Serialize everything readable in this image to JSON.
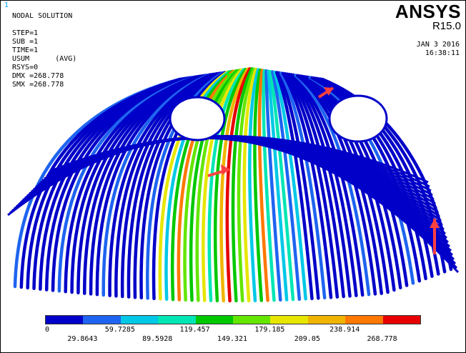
{
  "window": {
    "number": "1"
  },
  "header": {
    "plot_title": "NODAL SOLUTION",
    "step": "STEP=1",
    "sub": "SUB =1",
    "time": "TIME=1",
    "usum": "USUM      (AVG)",
    "rsys": "RSYS=0",
    "dmx": "DMX =268.778",
    "smx": "SMX =268.778"
  },
  "brand": {
    "name": "ANSYS",
    "version": "R15.0"
  },
  "timestamp": {
    "date": "JAN  3 2016",
    "time": "16:38:11"
  },
  "legend": {
    "colors": [
      "#0000c8",
      "#1e64f0",
      "#00c8e6",
      "#00e6b4",
      "#00c800",
      "#64e600",
      "#e6e600",
      "#f0b400",
      "#ff7800",
      "#e60000"
    ],
    "top_labels": [
      "0",
      "59.7285",
      "119.457",
      "179.185",
      "238.914"
    ],
    "bottom_labels": [
      "29.8643",
      "89.5928",
      "149.321",
      "209.05",
      "268.778"
    ]
  },
  "annotations": [
    {
      "name": "arrow-left-band",
      "color": "#ff4040"
    },
    {
      "name": "arrow-upper-right",
      "color": "#ff4040"
    },
    {
      "name": "arrow-right-edge",
      "color": "#ff4040"
    }
  ]
}
